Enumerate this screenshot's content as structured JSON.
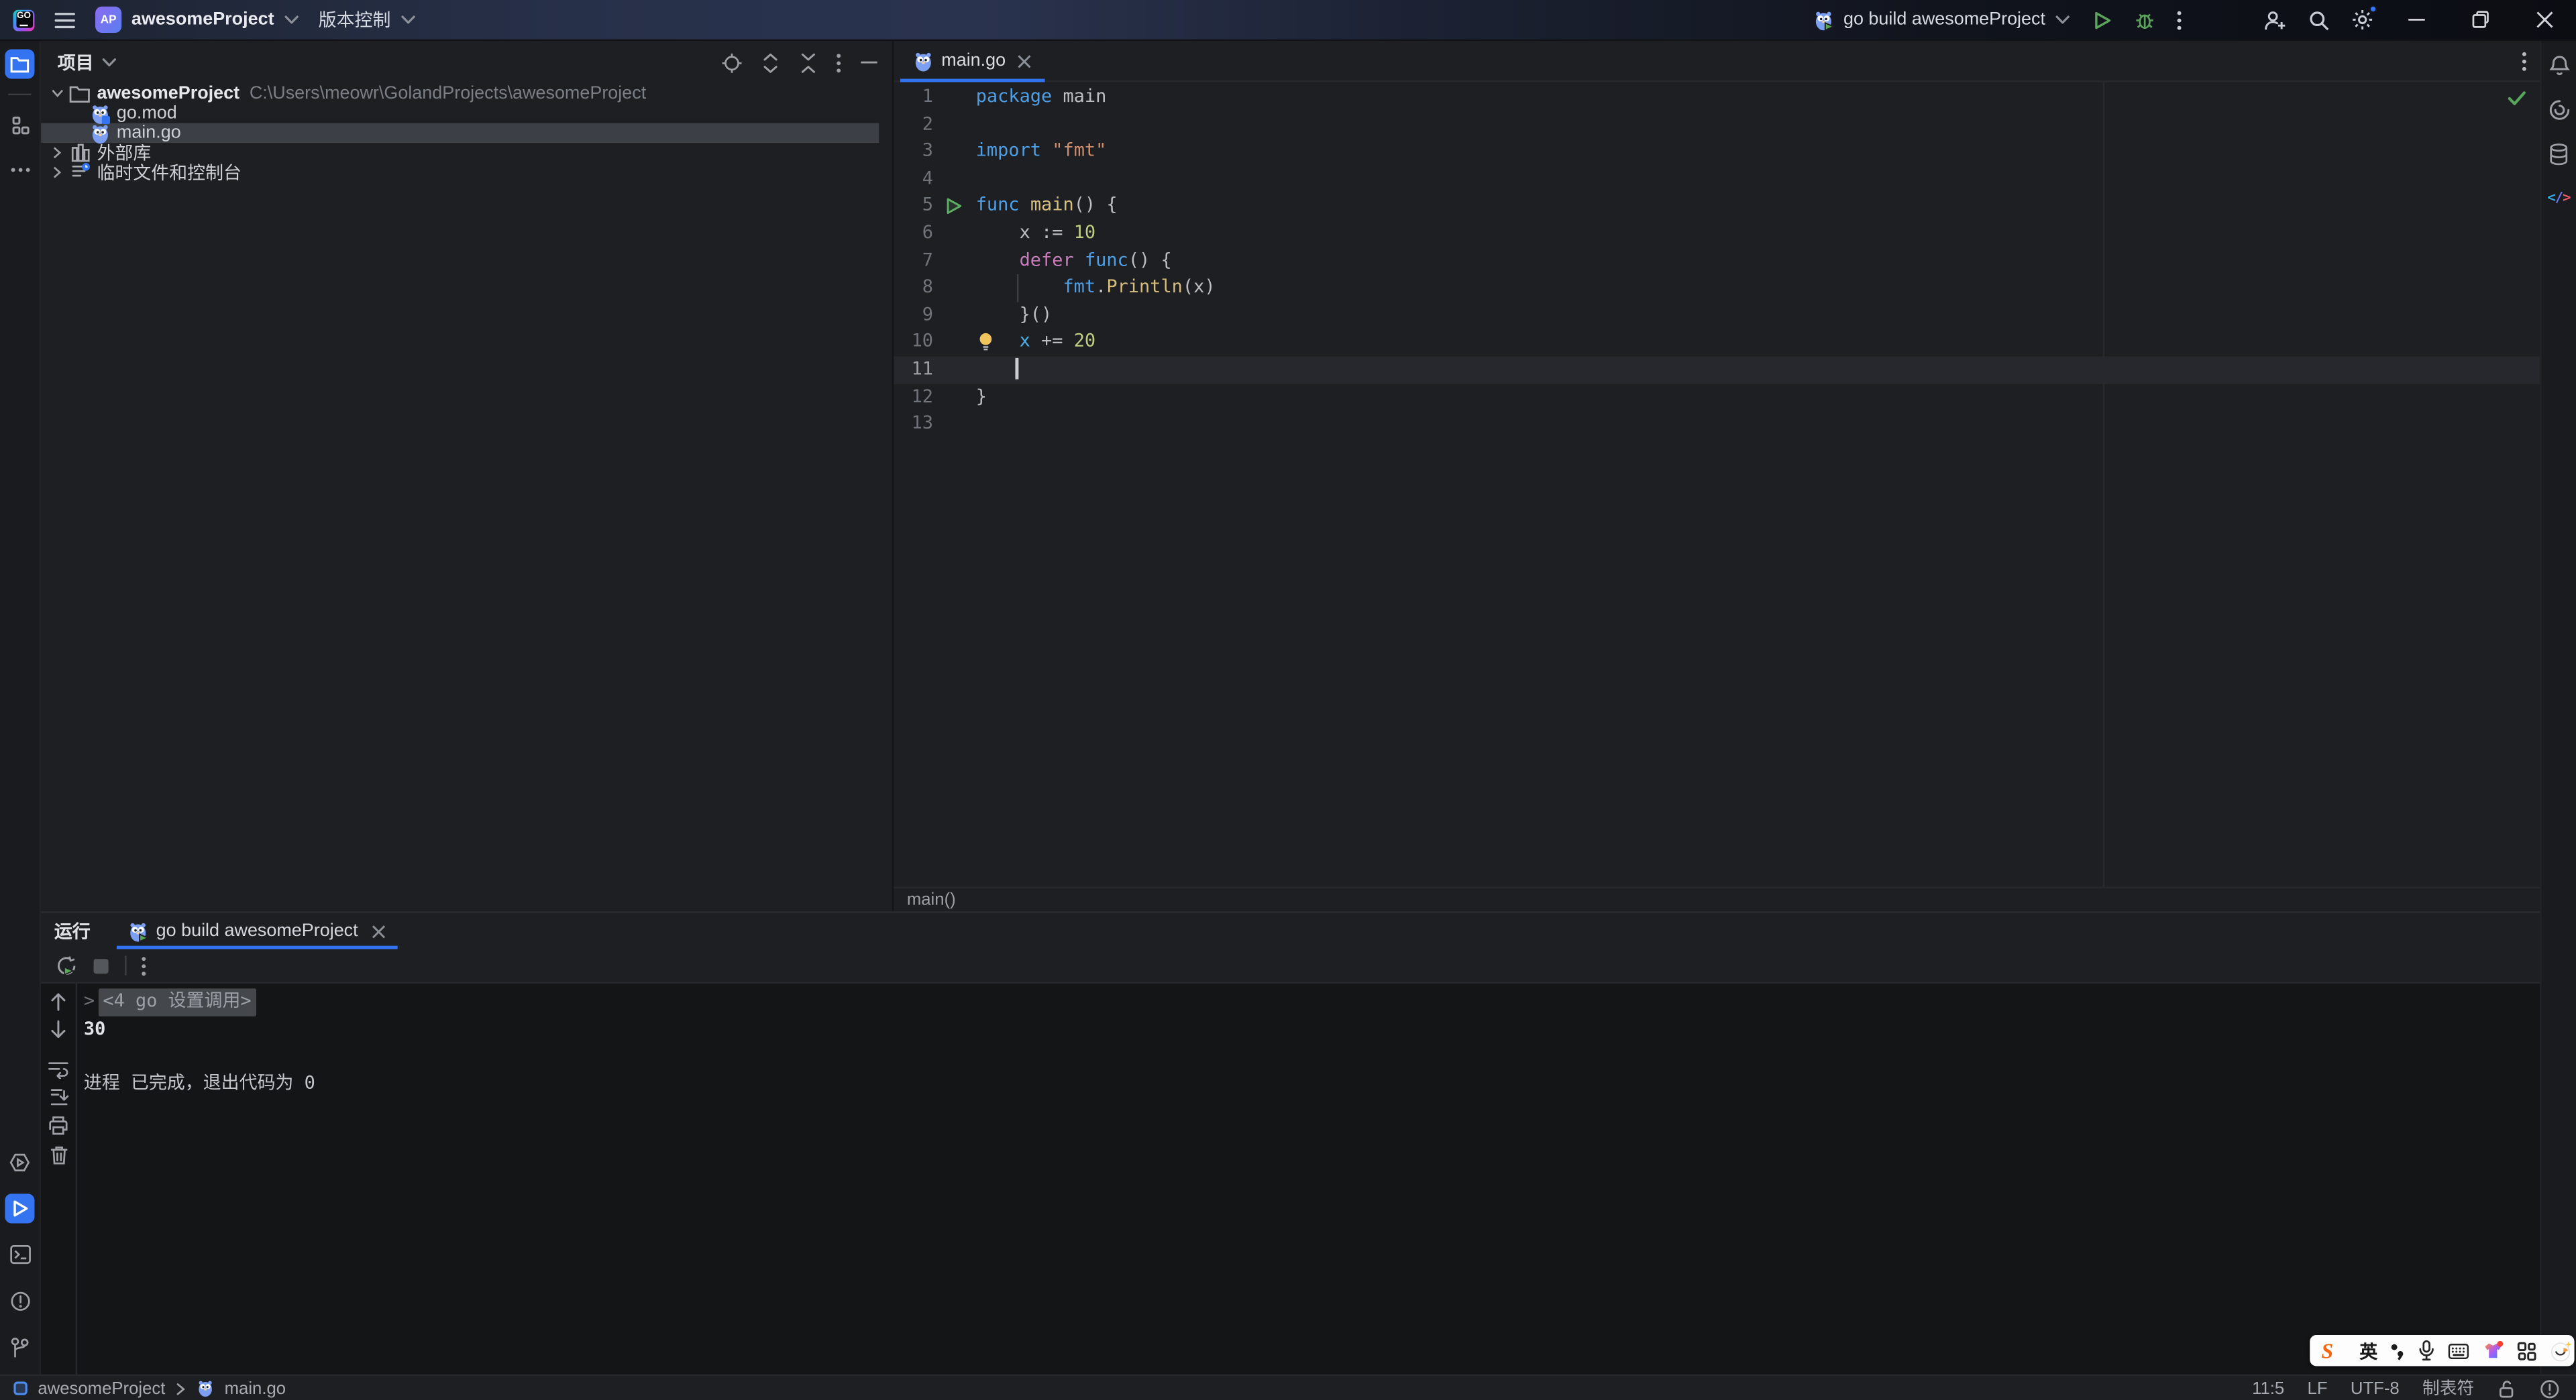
{
  "titlebar": {
    "logo_text": "GO",
    "project_badge": "AP",
    "project_name": "awesomeProject",
    "vcs_label": "版本控制",
    "run_config_label": "go build awesomeProject"
  },
  "left_toolbar": {
    "top": [
      "project-folder",
      "structure",
      "more-tool-windows"
    ],
    "bottom": [
      "services",
      "run",
      "terminal",
      "problems",
      "version-control"
    ]
  },
  "right_toolbar": [
    "notifications",
    "ai-assistant",
    "database",
    "endpoints"
  ],
  "project_panel": {
    "title": "项目",
    "toolbar_icons": [
      "select-opened-file",
      "expand-all",
      "collapse-all",
      "options",
      "hide"
    ],
    "tree": [
      {
        "label": "awesomeProject",
        "path": "C:\\Users\\meowr\\GolandProjects\\awesomeProject",
        "icon": "folder",
        "chevron": "expanded",
        "bold": true
      },
      {
        "label": "go.mod",
        "icon": "go-mod",
        "indent": 1
      },
      {
        "label": "main.go",
        "icon": "go-file",
        "indent": 1,
        "selected": true
      },
      {
        "label": "外部库",
        "icon": "library",
        "chevron": "collapsed"
      },
      {
        "label": "临时文件和控制台",
        "icon": "scratches",
        "chevron": "collapsed"
      }
    ]
  },
  "editor": {
    "tab_label": "main.go",
    "breadcrumb": "main()",
    "inspection_status": "ok",
    "syntax_colors": {
      "kw": "#4E9FE5",
      "kw2": "#C77DBB",
      "str": "#CE8E6D",
      "num": "#BDCE83",
      "fn": "#D6BE7C",
      "pkg": "#4E9FE5",
      "hl": "#4FB0E8",
      "pl": "#BCBEC4"
    },
    "lines": [
      {
        "n": 1,
        "tokens": [
          [
            "kw",
            "package"
          ],
          [
            "pl",
            " main"
          ]
        ]
      },
      {
        "n": 2,
        "tokens": []
      },
      {
        "n": 3,
        "tokens": [
          [
            "kw",
            "import"
          ],
          [
            "pl",
            " "
          ],
          [
            "str",
            "\"fmt\""
          ]
        ]
      },
      {
        "n": 4,
        "tokens": []
      },
      {
        "n": 5,
        "marker": "run",
        "tokens": [
          [
            "kw",
            "func"
          ],
          [
            "pl",
            " "
          ],
          [
            "fn",
            "main"
          ],
          [
            "pl",
            "() {"
          ]
        ]
      },
      {
        "n": 6,
        "tokens": [
          [
            "pl",
            "    x := "
          ],
          [
            "num",
            "10"
          ]
        ]
      },
      {
        "n": 7,
        "tokens": [
          [
            "pl",
            "    "
          ],
          [
            "kw2",
            "defer"
          ],
          [
            "pl",
            " "
          ],
          [
            "kw",
            "func"
          ],
          [
            "pl",
            "() {"
          ]
        ]
      },
      {
        "n": 8,
        "guide": true,
        "tokens": [
          [
            "pl",
            "        "
          ],
          [
            "pkg",
            "fmt"
          ],
          [
            "pl",
            "."
          ],
          [
            "fn",
            "Println"
          ],
          [
            "pl",
            "(x)"
          ]
        ]
      },
      {
        "n": 9,
        "tokens": [
          [
            "pl",
            "    }()"
          ]
        ]
      },
      {
        "n": 10,
        "marker": "bulb",
        "tokens": [
          [
            "pl",
            "    "
          ],
          [
            "hl",
            "x"
          ],
          [
            "pl",
            " += "
          ],
          [
            "num",
            "20"
          ]
        ]
      },
      {
        "n": 11,
        "caret": true,
        "tokens": [
          [
            "pl",
            "    "
          ]
        ]
      },
      {
        "n": 12,
        "tokens": [
          [
            "pl",
            "}"
          ]
        ]
      },
      {
        "n": 13,
        "tokens": []
      }
    ]
  },
  "run_panel": {
    "title": "运行",
    "tab_label": "go build awesomeProject",
    "toolbar_icons": [
      "rerun",
      "stop",
      "options"
    ],
    "gutter_icons": [
      "up",
      "down",
      "soft-wrap",
      "scroll-to-end",
      "print",
      "clear-all"
    ],
    "console": [
      {
        "type": "folded",
        "text": "<4 go 设置调用>"
      },
      {
        "type": "stdout",
        "text": "30"
      },
      {
        "type": "blank",
        "text": ""
      },
      {
        "type": "system",
        "text": "进程 已完成，退出代码为 0"
      }
    ]
  },
  "status_bar": {
    "module": "awesomeProject",
    "file": "main.go",
    "caret": "11:5",
    "line_sep": "LF",
    "encoding": "UTF-8",
    "indent": "制表符",
    "icons": [
      "lock-open",
      "error-notifications"
    ]
  },
  "ime_tray": {
    "brand": "S",
    "lang": "英",
    "icons": [
      "sogou-logo",
      "language-mode",
      "punctuation",
      "microphone",
      "keyboard",
      "skin",
      "toolbox",
      "emoji"
    ]
  },
  "colors": {
    "accent": "#3574F0",
    "editor_bg": "#1E1F22",
    "console_bg": "#141517",
    "selection_bg": "#3C3F45",
    "line_highlight": "#26282E",
    "run_green": "#5BA35C",
    "gopher_blue": "#7C9FF2",
    "bulb_yellow": "#F2C55C",
    "check_green": "#57A65A"
  }
}
